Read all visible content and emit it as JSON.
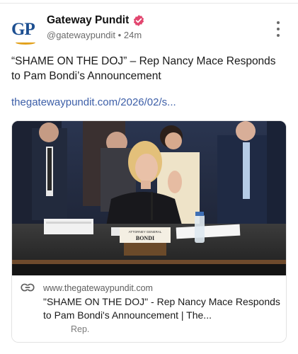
{
  "account": {
    "name": "Gateway Pundit",
    "handle": "@gatewaypundit",
    "separator": "•",
    "time": "24m",
    "avatar_text": "GP",
    "verified": true
  },
  "post": {
    "text": "“SHAME ON THE DOJ” – Rep Nancy Mace Responds to Pam Bondi’s Announcement",
    "link": "thegatewaypundit.com/2026/02/s..."
  },
  "card": {
    "domain": "www.thegatewaypundit.com",
    "title": "\"SHAME ON THE DOJ\" - Rep Nancy Mace Responds to Pam Bondi's Announcement | The...",
    "description": "Rep.",
    "nameplate_top": "ATTORNEY GENERAL",
    "nameplate_name": "BONDI"
  },
  "icons": {
    "more": "more-vertical-icon",
    "link": "link-icon",
    "verified": "verified-badge-icon"
  },
  "colors": {
    "link": "#3d5fa8",
    "brand_blue": "#1d4f91",
    "brand_gold": "#e2a11c",
    "verified": "#e2466f"
  }
}
